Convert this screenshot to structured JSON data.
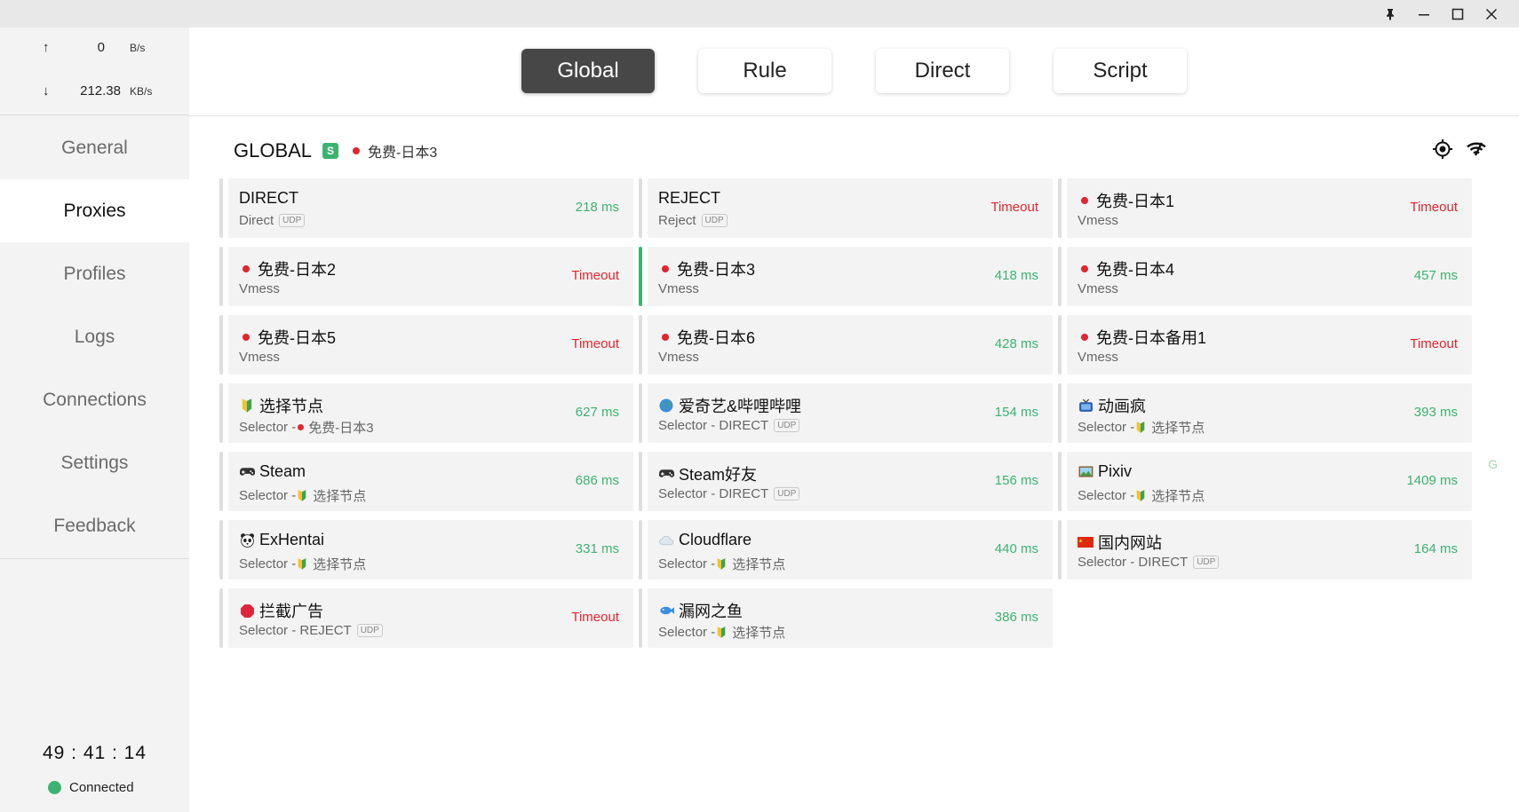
{
  "traffic": {
    "up_arrow": "↑",
    "up_value": "0",
    "up_unit": "B/s",
    "down_arrow": "↓",
    "down_value": "212.38",
    "down_unit": "KB/s"
  },
  "nav": [
    {
      "label": "General"
    },
    {
      "label": "Proxies"
    },
    {
      "label": "Profiles"
    },
    {
      "label": "Logs"
    },
    {
      "label": "Connections"
    },
    {
      "label": "Settings"
    },
    {
      "label": "Feedback"
    }
  ],
  "timer": "49 : 41 : 14",
  "status_label": "Connected",
  "modes": [
    {
      "label": "Global"
    },
    {
      "label": "Rule"
    },
    {
      "label": "Direct"
    },
    {
      "label": "Script"
    }
  ],
  "group": {
    "name": "GLOBAL",
    "badge": "S",
    "current": "免费-日本3"
  },
  "side_letter": "G",
  "proxies": [
    {
      "name": "DIRECT",
      "sub": "Direct",
      "udp": "UDP",
      "delay": "218 ms",
      "ok": true
    },
    {
      "name": "REJECT",
      "sub": "Reject",
      "udp": "UDP",
      "delay": "Timeout",
      "ok": false
    },
    {
      "name": "免费-日本1",
      "sub": "Vmess",
      "delay": "Timeout",
      "ok": false
    },
    {
      "name": "免费-日本2",
      "sub": "Vmess",
      "delay": "Timeout",
      "ok": false
    },
    {
      "name": "免费-日本3",
      "sub": "Vmess",
      "delay": "418 ms",
      "ok": true
    },
    {
      "name": "免费-日本4",
      "sub": "Vmess",
      "delay": "457 ms",
      "ok": true
    },
    {
      "name": "免费-日本5",
      "sub": "Vmess",
      "delay": "Timeout",
      "ok": false
    },
    {
      "name": "免费-日本6",
      "sub": "Vmess",
      "delay": "428 ms",
      "ok": true
    },
    {
      "name": "免费-日本备用1",
      "sub": "Vmess",
      "delay": "Timeout",
      "ok": false
    },
    {
      "name": "选择节点",
      "sub_prefix": "Selector - ",
      "sub_target": "免费-日本3",
      "delay": "627 ms",
      "ok": true
    },
    {
      "name": "爱奇艺&哔哩哔哩",
      "sub": "Selector - DIRECT",
      "udp": "UDP",
      "delay": "154 ms",
      "ok": true
    },
    {
      "name": "动画疯",
      "sub_prefix": "Selector - ",
      "sub_target": "选择节点",
      "delay": "393 ms",
      "ok": true
    },
    {
      "name": "Steam",
      "sub_prefix": "Selector - ",
      "sub_target": "选择节点",
      "delay": "686 ms",
      "ok": true
    },
    {
      "name": "Steam好友",
      "sub": "Selector - DIRECT",
      "udp": "UDP",
      "delay": "156 ms",
      "ok": true
    },
    {
      "name": "Pixiv",
      "sub_prefix": "Selector - ",
      "sub_target": "选择节点",
      "delay": "1409 ms",
      "ok": true
    },
    {
      "name": "ExHentai",
      "sub_prefix": "Selector - ",
      "sub_target": "选择节点",
      "delay": "331 ms",
      "ok": true
    },
    {
      "name": "Cloudflare",
      "sub_prefix": "Selector - ",
      "sub_target": "选择节点",
      "delay": "440 ms",
      "ok": true
    },
    {
      "name": "国内网站",
      "sub": "Selector - DIRECT",
      "udp": "UDP",
      "delay": "164 ms",
      "ok": true
    },
    {
      "name": "拦截广告",
      "sub": "Selector - REJECT",
      "udp": "UDP",
      "delay": "Timeout",
      "ok": false
    },
    {
      "name": "漏网之鱼",
      "sub_prefix": "Selector - ",
      "sub_target": "选择节点",
      "delay": "386 ms",
      "ok": true
    }
  ],
  "colors": {
    "ok": "#3cb371",
    "bad": "#e0262e",
    "active_mode": "#474747"
  }
}
